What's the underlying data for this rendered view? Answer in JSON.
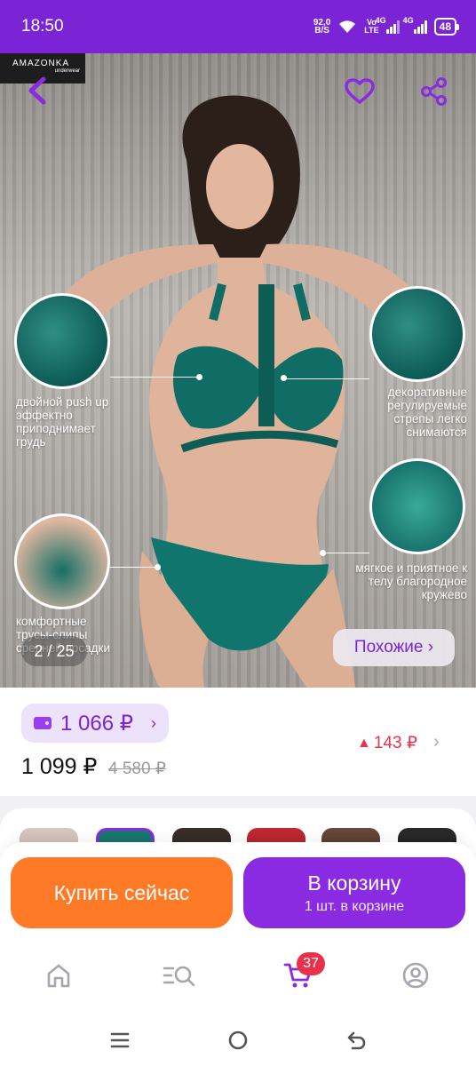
{
  "status_bar": {
    "time": "18:50",
    "net_speed_value": "92,0",
    "net_speed_unit": "B/S",
    "volte_top": "Vo",
    "volte_bottom": "LTE",
    "signal1_label": "4G",
    "signal2_label": "4G",
    "battery": "48",
    "icons": [
      "wifi-icon",
      "signal-icon",
      "battery-icon"
    ]
  },
  "product": {
    "brand_logo_line1": "AMAZONKA",
    "brand_logo_line2": "underwear",
    "photo_counter": "2 / 25",
    "similar_label": "Похожие ›",
    "callouts": [
      "двойной push up эффектно приподнимает грудь",
      "декоративные регулируемые стрепы легко снимаются",
      "мягкое и приятное к телу благородное кружево",
      "комфортные трусы-слипы средней посадки"
    ]
  },
  "price": {
    "wallet_price": "1 066 ₽",
    "wallet_chevron": "›",
    "current": "1 099 ₽",
    "old": "4 580 ₽",
    "diff": "143 ₽",
    "diff_arrow": "▲",
    "diff_chevron": "›"
  },
  "actions": {
    "buy_now": "Купить сейчас",
    "to_cart": "В корзину",
    "in_cart_note": "1 шт. в корзине"
  },
  "bottom_nav": {
    "items": [
      "home-icon",
      "catalog-search-icon",
      "cart-icon",
      "profile-icon"
    ],
    "cart_badge": "37"
  },
  "colors": {
    "accent": "#8a2be2",
    "status_bar": "#7b24d6",
    "buy_now": "#ff7a26",
    "price_up": "#e8314a"
  }
}
